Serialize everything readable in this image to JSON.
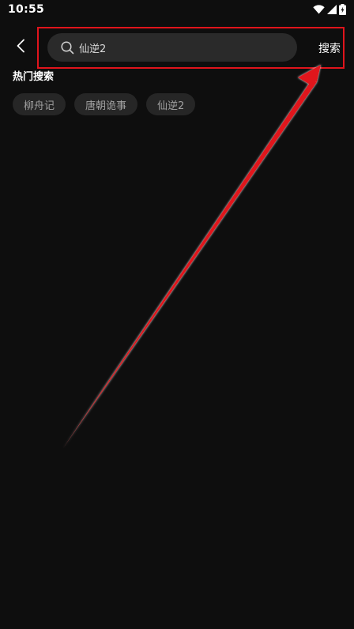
{
  "status_bar": {
    "time": "10:55"
  },
  "header": {
    "back_icon": "chevron-left-icon",
    "search": {
      "icon": "search-icon",
      "value": "仙逆2",
      "placeholder": ""
    },
    "submit_label": "搜索"
  },
  "hot_search": {
    "title": "热门搜索",
    "tags": [
      {
        "label": "柳舟记"
      },
      {
        "label": "唐朝诡事"
      },
      {
        "label": "仙逆2"
      }
    ]
  },
  "colors": {
    "background": "#0e0e0e",
    "search_bg": "#2a2a2a",
    "tag_bg": "#262626",
    "annotation_red": "#e0141c"
  }
}
